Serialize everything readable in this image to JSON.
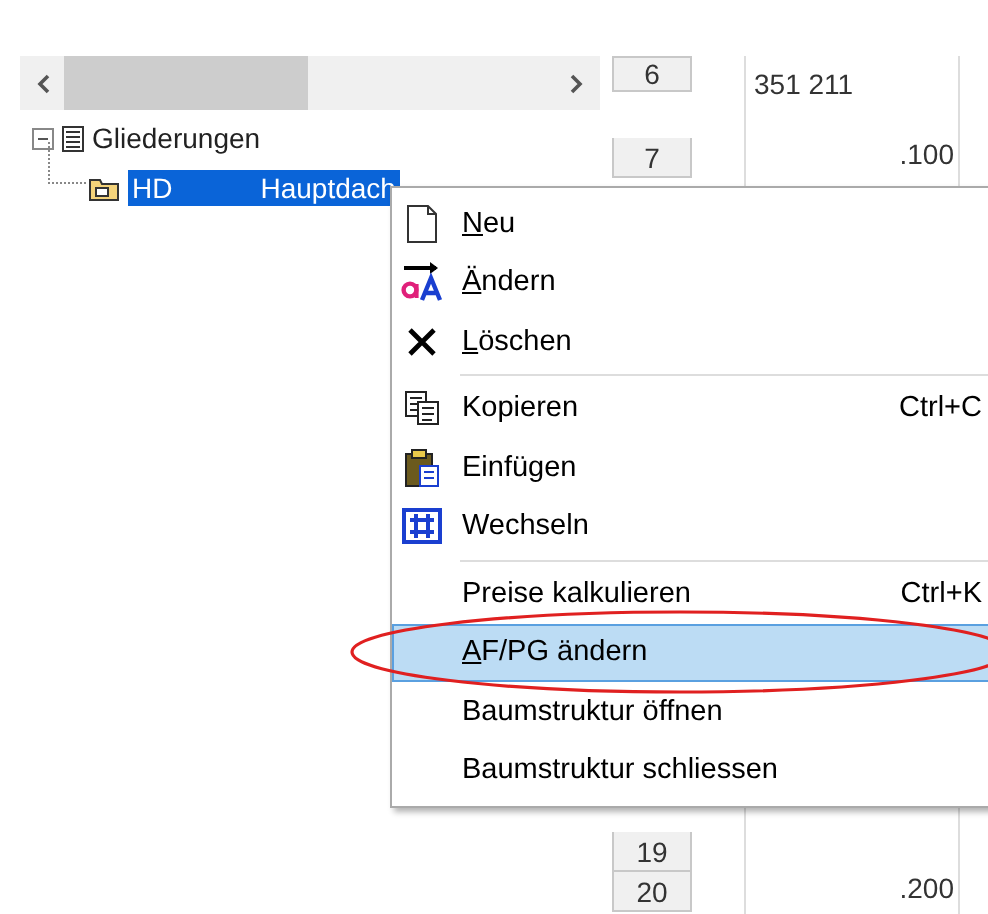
{
  "tree": {
    "items": [
      {
        "label": "Gliederungen",
        "expanded": true,
        "children": [
          {
            "code": "HD",
            "label": "Hauptdach",
            "selected": true
          }
        ]
      }
    ]
  },
  "grid": {
    "rows": [
      {
        "number": "6",
        "value": "351  211"
      },
      {
        "number": "7",
        "value": ".100"
      },
      {
        "number": "19"
      },
      {
        "number": "20",
        "value": ".200"
      }
    ]
  },
  "context_menu": {
    "items": [
      {
        "kind": "item",
        "label": "Neu",
        "underline_first": true,
        "selected": false
      },
      {
        "kind": "item",
        "label": "Ändern",
        "underline_first": true,
        "selected": false
      },
      {
        "kind": "item",
        "label": "Löschen",
        "underline_first": true,
        "selected": false
      },
      {
        "kind": "separator"
      },
      {
        "kind": "item",
        "label": "Kopieren",
        "shortcut": "Ctrl+C",
        "underline_first": false,
        "selected": false
      },
      {
        "kind": "item",
        "label": "Einfügen",
        "underline_first": false,
        "selected": false
      },
      {
        "kind": "item",
        "label": "Wechseln",
        "underline_first": false,
        "selected": false
      },
      {
        "kind": "separator"
      },
      {
        "kind": "item",
        "label": "Preise kalkulieren",
        "shortcut": "Ctrl+K",
        "underline_first": false,
        "selected": false
      },
      {
        "kind": "item",
        "label": "AF/PG ändern",
        "underline_first": true,
        "selected": true
      },
      {
        "kind": "item",
        "label": "Baumstruktur öffnen",
        "underline_first": false,
        "selected": false
      },
      {
        "kind": "item",
        "label": "Baumstruktur schliessen",
        "underline_first": false,
        "selected": false
      }
    ]
  }
}
